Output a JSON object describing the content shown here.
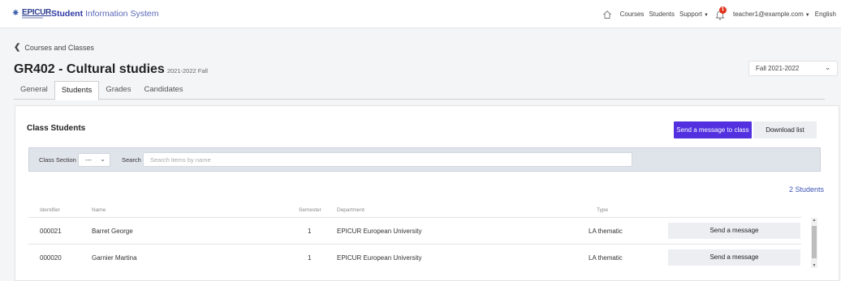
{
  "header": {
    "logo_text": "EPICUR",
    "app_title_bold": "Student",
    "app_title_rest": " Information System",
    "nav": [
      "Courses",
      "Students",
      "Support"
    ],
    "notification_count": "1",
    "user_email": "teacher1@example.com",
    "language": "English"
  },
  "breadcrumb": {
    "back_label": "Courses and Classes"
  },
  "page": {
    "title": "GR402 - Cultural studies",
    "subtitle": "2021-2022 Fall",
    "term_select": "Fall 2021-2022"
  },
  "tabs": [
    {
      "label": "General",
      "active": false
    },
    {
      "label": "Students",
      "active": true
    },
    {
      "label": "Grades",
      "active": false
    },
    {
      "label": "Candidates",
      "active": false
    }
  ],
  "panel": {
    "title": "Class Students",
    "send_class_button": "Send a message to class",
    "download_button": "Download list",
    "filter": {
      "section_label": "Class Section",
      "section_value": "---",
      "search_label": "Search",
      "search_placeholder": "Search items by name"
    },
    "count": "2 Students",
    "columns": [
      "Identifier",
      "Name",
      "Semester",
      "Department",
      "Type"
    ],
    "rows": [
      {
        "id": "000021",
        "name": "Barret George",
        "semester": "1",
        "department": "EPICUR European University",
        "type": "LA thematic",
        "action": "Send a message"
      },
      {
        "id": "000020",
        "name": "Garnier Martina",
        "semester": "1",
        "department": "EPICUR European University",
        "type": "LA thematic",
        "action": "Send a message"
      }
    ]
  },
  "colors": {
    "primary": "#5230e0",
    "brand": "#2c38a3",
    "link": "#3d55b5",
    "badge": "#e2341d"
  }
}
